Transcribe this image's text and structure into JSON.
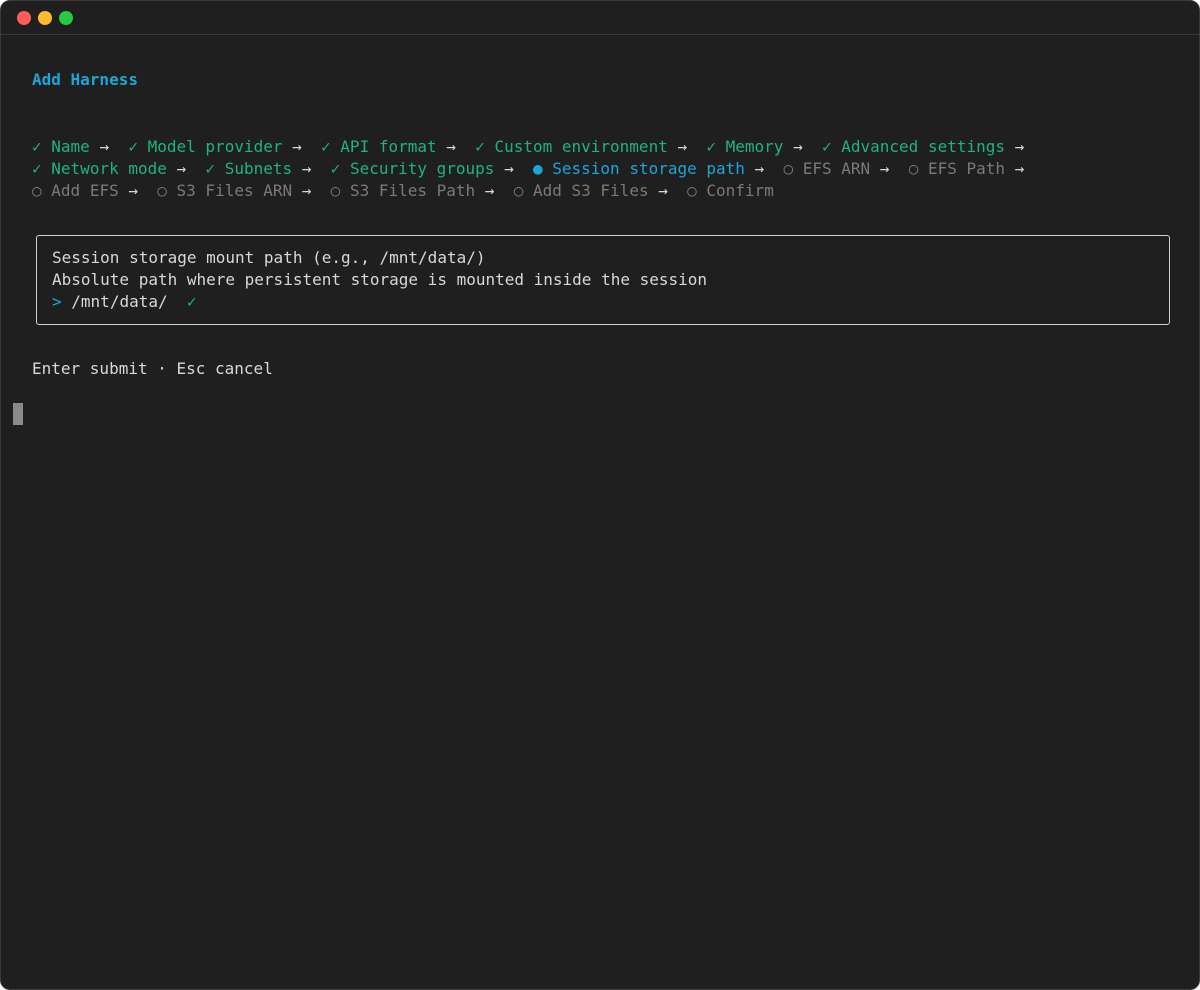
{
  "window": {
    "traffic_lights": [
      "close",
      "minimize",
      "zoom"
    ]
  },
  "header": {
    "title": "Add Harness"
  },
  "steps": {
    "done_mark": "✓",
    "active_mark": "●",
    "pending_mark": "○",
    "arrow": "→",
    "rows": [
      [
        {
          "label": "Name",
          "state": "done"
        },
        {
          "label": "Model provider",
          "state": "done"
        },
        {
          "label": "API format",
          "state": "done"
        },
        {
          "label": "Custom environment",
          "state": "done"
        },
        {
          "label": "Memory",
          "state": "done"
        },
        {
          "label": "Advanced settings",
          "state": "done"
        }
      ],
      [
        {
          "label": "Network mode",
          "state": "done"
        },
        {
          "label": "Subnets",
          "state": "done"
        },
        {
          "label": "Security groups",
          "state": "done"
        },
        {
          "label": "Session storage path",
          "state": "active"
        },
        {
          "label": "EFS ARN",
          "state": "pending"
        },
        {
          "label": "EFS Path",
          "state": "pending"
        }
      ],
      [
        {
          "label": "Add EFS",
          "state": "pending"
        },
        {
          "label": "S3 Files ARN",
          "state": "pending"
        },
        {
          "label": "S3 Files Path",
          "state": "pending"
        },
        {
          "label": "Add S3 Files",
          "state": "pending"
        },
        {
          "label": "Confirm",
          "state": "pending"
        }
      ]
    ]
  },
  "prompt": {
    "label": "Session storage mount path (e.g., /mnt/data/)",
    "help": "Absolute path where persistent storage is mounted inside the session",
    "caret": ">",
    "value": "/mnt/data/",
    "valid_mark": "✓"
  },
  "footer": {
    "hint": "Enter submit · Esc cancel"
  },
  "colors": {
    "background": "#1f1f1f",
    "accent": "#1aa6d8",
    "success": "#1db47e",
    "muted": "#7a7a7a",
    "text": "#d8d8d8"
  }
}
